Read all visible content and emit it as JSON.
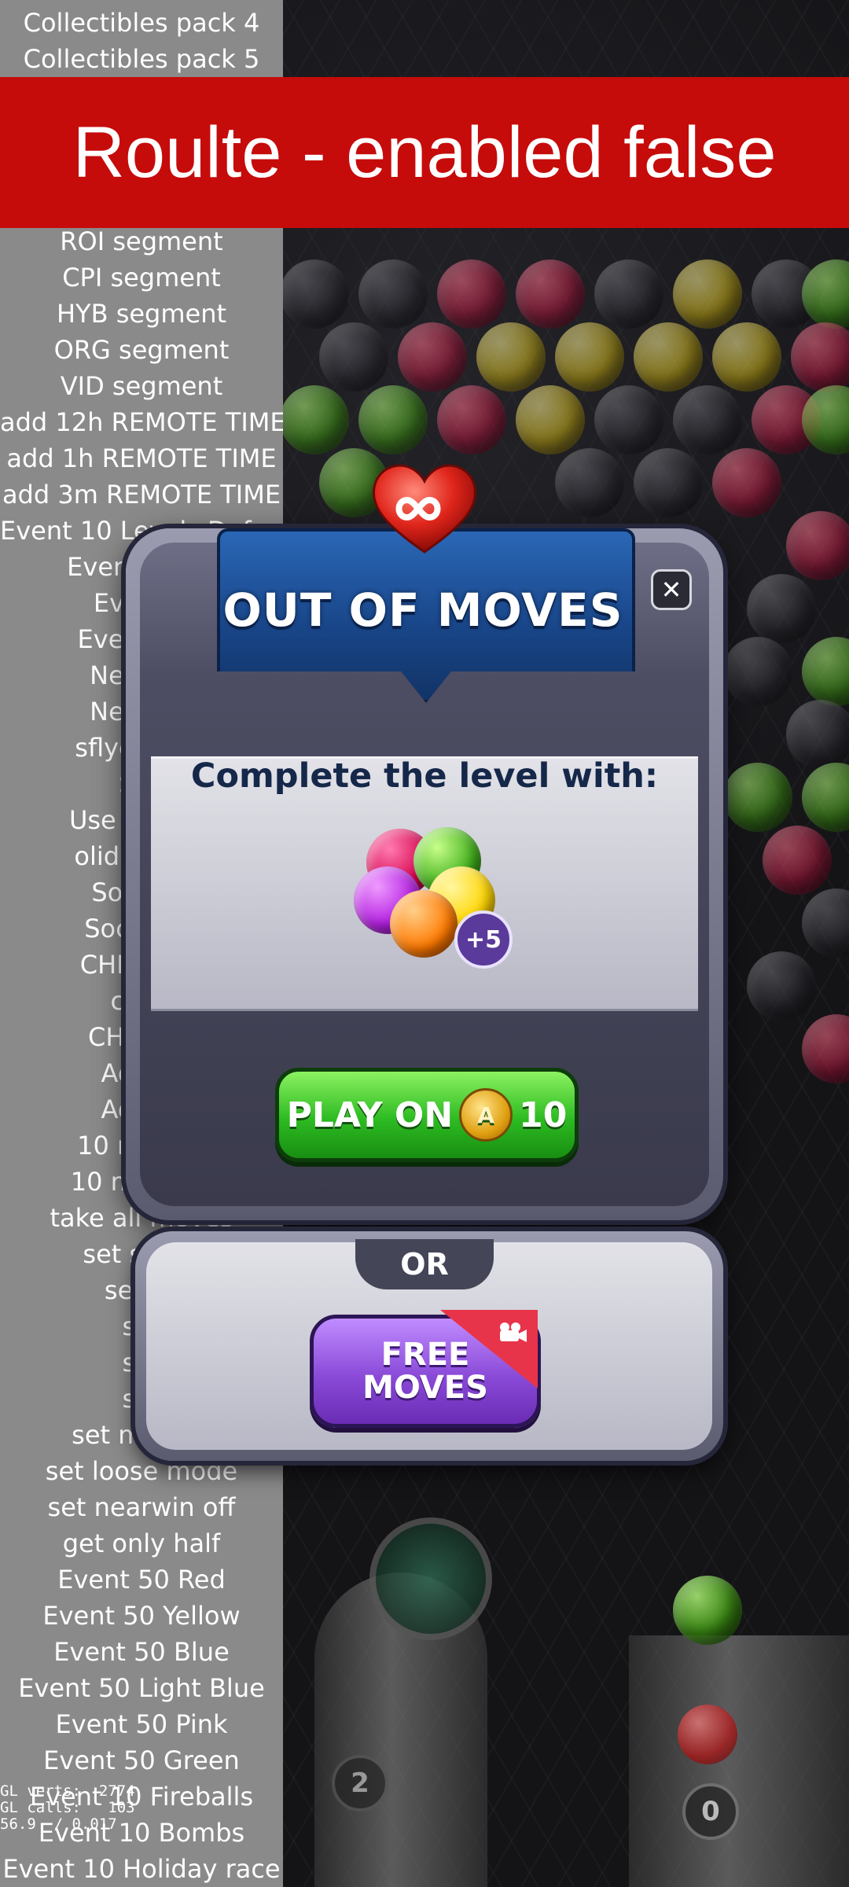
{
  "debug_menu": {
    "items": [
      "Collectibles pack 4",
      "Collectibles pack 5",
      "ROI segment",
      "CPI segment",
      "HYB segment",
      "ORG segment",
      "VID segment",
      "add 12h REMOTE TIME",
      "add 1h REMOTE TIME",
      "add 3m REMOTE TIME",
      "Event 10 Levels Default",
      "Event 10 Le",
      "Event 1",
      "Event 200",
      "New ver",
      "New ver",
      "sflyer purc",
      "Soc",
      "Use second",
      "oliday sale",
      "Social R",
      "Social Re",
      "CHEAT 10",
      "clear",
      "CHEAT S",
      "Add fa",
      "Add fa",
      "10 minute",
      "10 minutes",
      "take all moves",
      "set super",
      "set wi",
      "set",
      "set",
      "set",
      "set mid loo",
      "set loose mode",
      "set nearwin off",
      "get only half",
      "Event 50 Red",
      "Event 50 Yellow",
      "Event 50 Blue",
      "Event 50 Light Blue",
      "Event 50 Pink",
      "Event 50 Green",
      "Event 10 Fireballs",
      "Event 10 Bombs",
      "Event 10 Holiday race"
    ]
  },
  "banner": {
    "text": "Roulte - enabled false"
  },
  "dialog": {
    "title": "OUT OF MOVES",
    "close_symbol": "✕",
    "subtitle": "Complete the level with:",
    "reward_badge": "+5",
    "play_on": {
      "label": "PLAY ON",
      "coin_symbol": "A",
      "price": "10"
    },
    "or_label": "OR",
    "free_moves_label": "FREE\nMOVES"
  },
  "game": {
    "shots_badge": "2",
    "queue_badge": "0"
  },
  "gl_stats": {
    "line1": "GL verts:  2774",
    "line2": "GL calls:   103",
    "line3": "56.9  / 0.017"
  },
  "colors": {
    "banner": "#c60b0b",
    "menu_bg": "#8a8a8a",
    "ribbon": "#184486",
    "play_on": "#2dbb22",
    "free_moves": "#8a4ad8"
  }
}
